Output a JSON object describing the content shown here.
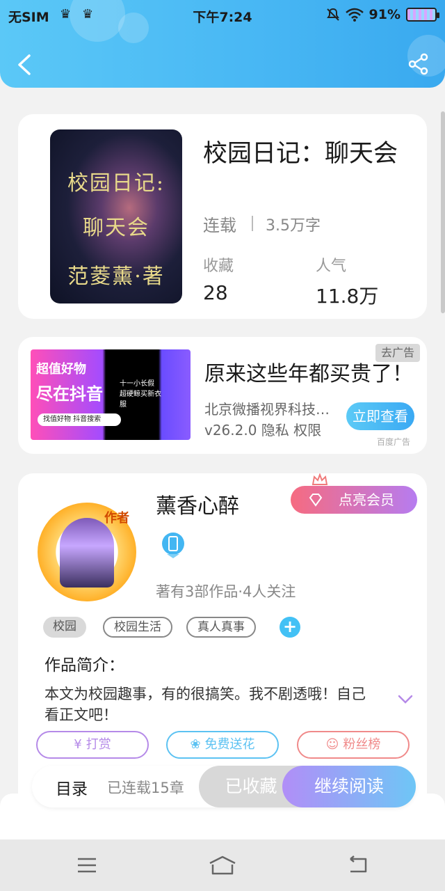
{
  "status_bar": {
    "sim": "无SIM",
    "time": "下午7:24",
    "battery": "91%"
  },
  "header": {
    "back_icon": "chevron-left-icon",
    "share_icon": "share-icon",
    "gradient": [
      "#5bc8f7",
      "#39a9ef"
    ]
  },
  "book": {
    "cover_lines": [
      "校园日记:",
      "聊天会",
      "范菱薰·著"
    ],
    "title": "校园日记：聊天会",
    "status": "连载",
    "word_count": "3.5万字",
    "favorites_label": "收藏",
    "favorites_value": "28",
    "popularity_label": "人气",
    "popularity_value": "11.8万"
  },
  "ad": {
    "image_line1": "超值好物",
    "image_line2": "尽在抖音",
    "image_line3": "十一小长假 超硬鲸买新衣服",
    "image_pill": "找值好物 抖音搜索",
    "close_label": "去广告",
    "title": "原来这些年都买贵了！",
    "company": "北京微播视界科技…",
    "meta": "v26.2.0  隐私  权限",
    "cta": "立即查看",
    "source": "百度广告"
  },
  "author": {
    "avatar_badge": "作者",
    "name": "薰香心醉",
    "vip_label": "点亮会员",
    "stats": "著有3部作品·4人关注",
    "tags": [
      "校园",
      "校园生活",
      "真人真事"
    ],
    "tag_add": "+",
    "intro_heading": "作品简介：",
    "intro_text": "本文为校园趣事，有的很搞笑。我不剧透哦！自己看正文吧！",
    "actions": [
      {
        "label": "打赏",
        "icon": "yen-icon",
        "color": "#b58ae8"
      },
      {
        "label": "免费送花",
        "icon": "flower-icon",
        "color": "#5cc2f2"
      },
      {
        "label": "粉丝榜",
        "icon": "user-icon",
        "color": "#f08a8a"
      }
    ]
  },
  "bottom_bar": {
    "toc_label": "目录",
    "toc_progress": "已连载15章",
    "collected_label": "已收藏",
    "continue_label": "继续阅读"
  },
  "navbar": {
    "menu_icon": "menu-icon",
    "home_icon": "home-icon",
    "back_icon": "back-icon"
  }
}
